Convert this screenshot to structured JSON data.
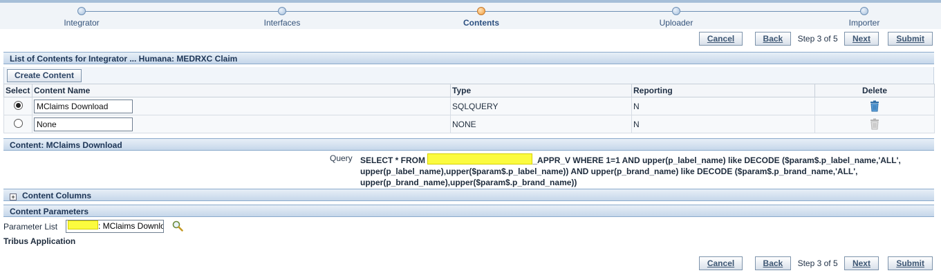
{
  "train": {
    "steps": [
      {
        "label": "Integrator",
        "state": "visited"
      },
      {
        "label": "Interfaces",
        "state": "visited"
      },
      {
        "label": "Contents",
        "state": "current"
      },
      {
        "label": "Uploader",
        "state": "pending"
      },
      {
        "label": "Importer",
        "state": "pending"
      }
    ]
  },
  "nav": {
    "cancel": "Cancel",
    "back": "Back",
    "step_text": "Step 3 of 5",
    "next": "Next",
    "submit": "Submit"
  },
  "list": {
    "header": "List of Contents for Integrator ... Humana: MEDRXC Claim",
    "create_button": "Create Content",
    "columns": {
      "select": "Select",
      "name": "Content Name",
      "type": "Type",
      "reporting": "Reporting",
      "delete": "Delete"
    },
    "rows": [
      {
        "selected": true,
        "name": "MClaims Download",
        "type": "SQLQUERY",
        "reporting": "N",
        "delete_enabled": true
      },
      {
        "selected": false,
        "name": "None",
        "type": "NONE",
        "reporting": "N",
        "delete_enabled": false
      }
    ]
  },
  "content": {
    "header": "Content: MClaims Download",
    "query_label": "Query",
    "query_prefix": "SELECT * FROM",
    "query_rest": "_APPR_V WHERE 1=1 AND upper(p_label_name) like DECODE ($param$.p_label_name,'ALL', upper(p_label_name),upper($param$.p_label_name)) AND upper(p_brand_name) like DECODE ($param$.p_brand_name,'ALL', upper(p_brand_name),upper($param$.p_brand_name))"
  },
  "content_columns": {
    "header": "Content Columns"
  },
  "content_parameters": {
    "header": "Content Parameters",
    "param_label": "Parameter List",
    "param_value": ": MClaims Downlo",
    "app_name": "Tribus Application"
  },
  "colors": {
    "highlight": "#fbfb3f",
    "header_text": "#1d3556",
    "current_step": "#f19b3b"
  },
  "icons": {
    "delete": "trash-icon",
    "search": "magnifier-icon",
    "expand": "plus-icon"
  }
}
